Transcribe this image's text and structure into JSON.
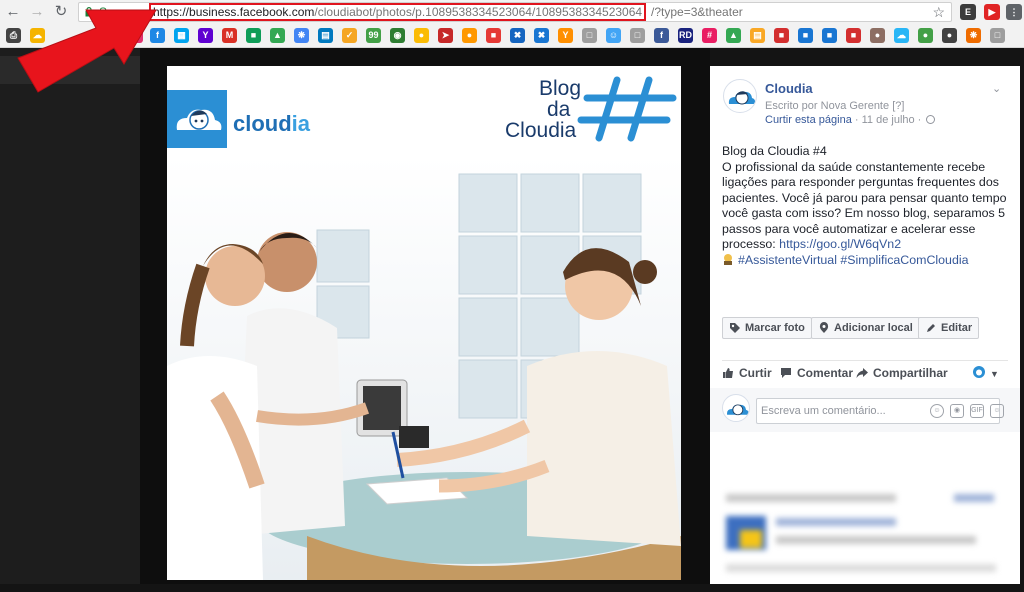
{
  "browser": {
    "secure_label": "Seguro",
    "url_host": "https://business.facebook.com",
    "url_path": "/cloudiabot/photos/p.1089538334523064/1089538334523064",
    "url_query": "/?type=3&theater"
  },
  "photo": {
    "logo_brand_a": "cloud",
    "logo_brand_b": "ia",
    "blog_title_l1": "Blog",
    "blog_title_l2": "da",
    "blog_title_l3": "Cloudia"
  },
  "post": {
    "page_name": "Cloudia",
    "written_by": "Escrito por Nova Gerente",
    "written_by_q": "[?]",
    "like_page": "Curtir esta página",
    "meta_sep": " · ",
    "date": "11 de julho",
    "text_title": "Blog da Cloudia #4",
    "text_body": "O profissional da saúde constantemente recebe ligações para responder perguntas frequentes dos pacientes. Você já parou para pensar quanto tempo você gasta com isso? Em nosso blog, separamos 5 passos para você automatizar e acelerar esse processo: ",
    "link": "https://goo.gl/W6qVn2",
    "hashtags": "#AssistenteVirtual #SimplificaComCloudia"
  },
  "actions": {
    "tag_photo": "Marcar foto",
    "add_location": "Adicionar local",
    "edit": "Editar"
  },
  "reactions": {
    "like": "Curtir",
    "comment": "Comentar",
    "share": "Compartilhar"
  },
  "comment_box": {
    "placeholder": "Escreva um comentário...",
    "gif_label": "GIF"
  },
  "colors": {
    "facebook_blue": "#365899",
    "url_highlight": "#e0141e",
    "arrow_red": "#e8141c",
    "brand_blue": "#2b8fd4"
  }
}
